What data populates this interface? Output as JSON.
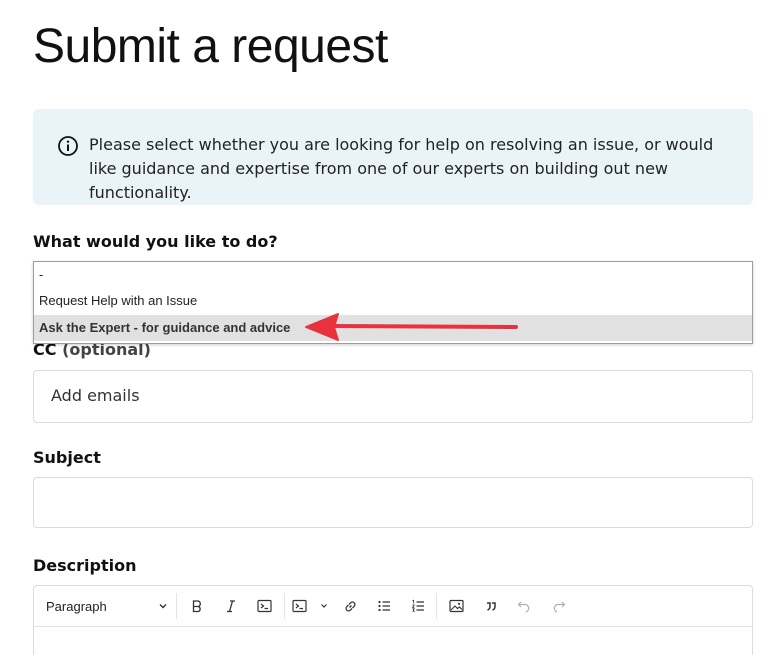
{
  "page": {
    "title": "Submit a request"
  },
  "notice": {
    "icon": "info-circle-icon",
    "text": "Please select whether you are looking for help on resolving an issue, or would like guidance and expertise from one of our experts on building out new functionality."
  },
  "request_type": {
    "label": "What would you like to do?",
    "options": [
      "-",
      "Request Help with an Issue",
      "Ask the Expert - for guidance and advice"
    ],
    "highlighted": "Ask the Expert - for guidance and advice"
  },
  "cc": {
    "label": "CC",
    "optional": "(optional)",
    "placeholder": "Add emails"
  },
  "subject": {
    "label": "Subject",
    "value": ""
  },
  "description": {
    "label": "Description",
    "toolbar": {
      "block_format": "Paragraph",
      "icons": [
        "chevron-down-icon",
        "bold-icon",
        "italic-icon",
        "code-icon",
        "code-block-icon",
        "link-icon",
        "bulleted-list-icon",
        "numbered-list-icon",
        "image-icon",
        "blockquote-icon",
        "undo-icon",
        "redo-icon"
      ]
    }
  },
  "annotation": {
    "arrow_color": "#e8333f"
  }
}
